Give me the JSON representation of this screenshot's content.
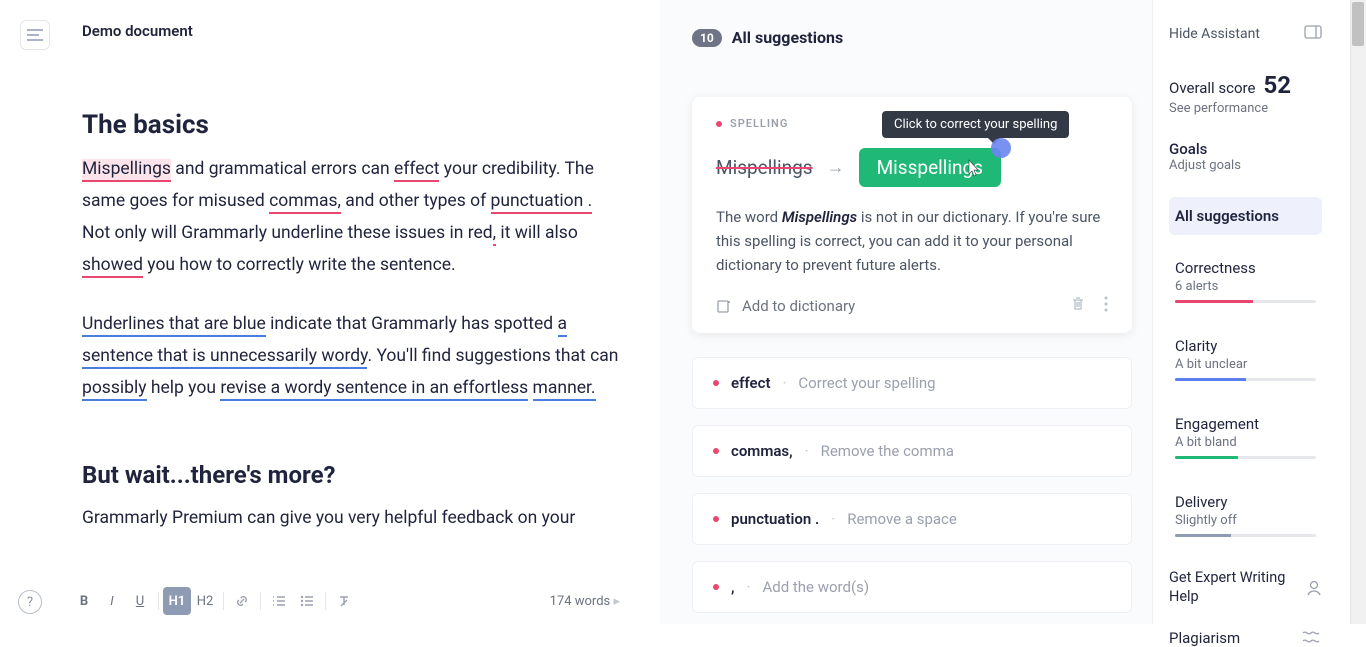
{
  "doc": {
    "title": "Demo document"
  },
  "headings": {
    "h1": "The basics",
    "h2": "But wait...there's more?"
  },
  "para1": {
    "w_mispellings": "Mispellings",
    "t1": " and grammatical errors can ",
    "w_effect": "effect",
    "t2": " your credibility. The same goes for misused ",
    "w_commas": "commas,",
    "t3": " and other types of ",
    "w_punct": "punctuation .",
    "t4": " Not only will Grammarly underline these issues in red",
    "w_comma2": ",",
    "t5": " it will also ",
    "w_showed": "showed",
    "t6": " you how to correctly write the sentence."
  },
  "para2": {
    "w_under": "Underlines that are blue",
    "t1": " indicate that Grammarly has spotted ",
    "w_a": "a",
    "t1b": " ",
    "w_sent": "sentence that is unnecessarily wordy",
    "t2": ". You'll find suggestions that can ",
    "w_poss": "possibly",
    "t3": " help you ",
    "w_rev": "revise a wordy sentence in an effortless",
    "t3b": " ",
    "w_man": "manner.",
    "t4": ""
  },
  "para3": "Grammarly Premium can give you very helpful feedback on your",
  "toolbar": {
    "b": "B",
    "i": "I",
    "u": "U",
    "h1": "H1",
    "h2": "H2"
  },
  "wordcount": "174 words",
  "suggestions": {
    "count": "10",
    "title": "All suggestions",
    "card": {
      "category": "SPELLING",
      "tooltip": "Click to correct your spelling",
      "wrong": "Mispellings",
      "right": "Misspellings",
      "explain_pre": "The word ",
      "explain_word": "Mispellings",
      "explain_post": " is not in our dictionary. If you're sure this spelling is correct, you can add it to your personal dictionary to prevent future alerts.",
      "add_dict": "Add to dictionary"
    },
    "items": [
      {
        "word": "effect",
        "hint": "Correct your spelling"
      },
      {
        "word": "commas,",
        "hint": "Remove the comma"
      },
      {
        "word": "punctuation .",
        "hint": "Remove a space"
      },
      {
        "word": ",",
        "hint": "Add the word(s)"
      }
    ]
  },
  "sidebar": {
    "hide": "Hide Assistant",
    "overall_label": "Overall score",
    "overall_value": "52",
    "see_perf": "See performance",
    "goals_title": "Goals",
    "goals_sub": "Adjust goals",
    "all_sugg": "All suggestions",
    "cats": [
      {
        "title": "Correctness",
        "sub": "6 alerts",
        "color": "#e9476f",
        "pct": 55
      },
      {
        "title": "Clarity",
        "sub": "A bit unclear",
        "color": "#5b7ef0",
        "pct": 50
      },
      {
        "title": "Engagement",
        "sub": "A bit bland",
        "color": "#1fb877",
        "pct": 45
      },
      {
        "title": "Delivery",
        "sub": "Slightly off",
        "color": "#8f9bb3",
        "pct": 40
      }
    ],
    "expert": "Get Expert Writing Help",
    "plag": "Plagiarism"
  }
}
